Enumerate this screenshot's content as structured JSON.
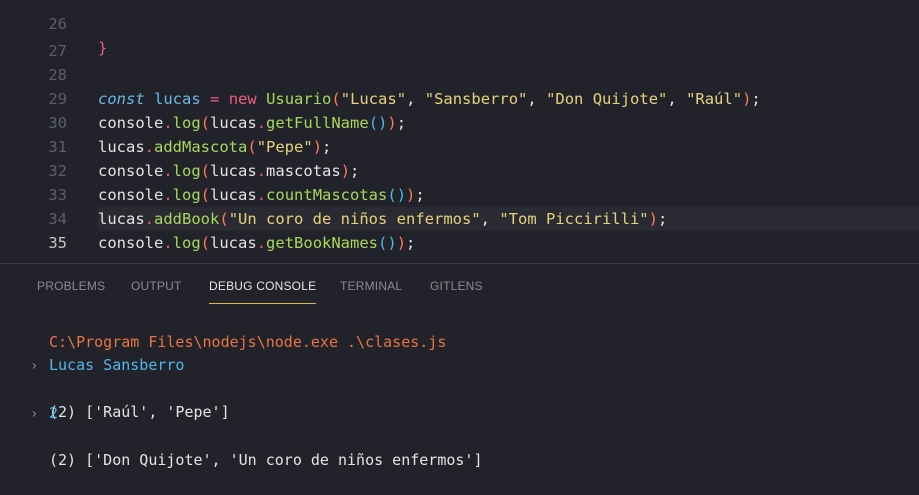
{
  "editor": {
    "line_numbers": [
      "26",
      "27",
      "28",
      "29",
      "30",
      "31",
      "32",
      "33",
      "34",
      "35"
    ],
    "lines": {
      "l26": "}",
      "l28": {
        "kw": "const",
        "var": "lucas",
        "op": "=",
        "new": "new",
        "cls": "Usuario",
        "s1": "\"Lucas\"",
        "s2": "\"Sansberro\"",
        "s3": "\"Don Quijote\"",
        "s4": "\"Raúl\"",
        "comma": ", ",
        "semi": ";"
      },
      "l29": {
        "obj": "console",
        "m": "log",
        "arg": "lucas",
        "m2": "getFullName",
        "semi": ";"
      },
      "l30": {
        "obj": "lucas",
        "m": "addMascota",
        "s": "\"Pepe\"",
        "semi": ";"
      },
      "l31": {
        "obj": "console",
        "m": "log",
        "arg": "lucas",
        "p": "mascotas",
        "semi": ";"
      },
      "l32": {
        "obj": "console",
        "m": "log",
        "arg": "lucas",
        "m2": "countMascotas",
        "semi": ";"
      },
      "l33": {
        "obj": "lucas",
        "m": "addBook",
        "s1": "\"Un coro de niños enfermos\"",
        "s2": "\"Tom Piccirilli\"",
        "semi": ";"
      },
      "l34": {
        "obj": "console",
        "m": "log",
        "arg": "lucas",
        "m2": "getBookNames",
        "semi": ";"
      }
    }
  },
  "panel": {
    "tabs": [
      "PROBLEMS",
      "OUTPUT",
      "DEBUG CONSOLE",
      "TERMINAL",
      "GITLENS"
    ],
    "active_tab": "DEBUG CONSOLE",
    "console": [
      {
        "text": "C:\\Program Files\\nodejs\\node.exe .\\clases.js",
        "color": "#e9743f",
        "chevron": false
      },
      {
        "text": "Lucas Sansberro",
        "color": "#4fb8e8",
        "chevron": false
      },
      {
        "text": "(2) ['Raúl', 'Pepe']",
        "color": "#e4e4e4",
        "chevron": true
      },
      {
        "text": "2",
        "color": "#4fb8e8",
        "chevron": false
      },
      {
        "text": "(2) ['Don Quijote', 'Un coro de niños enfermos']",
        "color": "#e4e4e4",
        "chevron": true
      }
    ]
  },
  "colors": {
    "background": "#22232a",
    "accent_tab": "#d8b94a"
  }
}
